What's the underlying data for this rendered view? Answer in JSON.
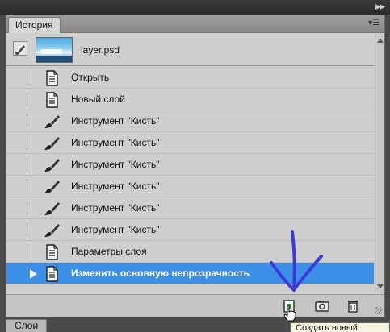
{
  "panel": {
    "tab_label": "История",
    "menu_icon": "panel-menu-icon",
    "collapse_icon": "double-arrow-right-icon"
  },
  "snapshot": {
    "name": "layer.psd"
  },
  "history": [
    {
      "label": "Открыть",
      "icon": "document-icon",
      "selected": false
    },
    {
      "label": "Новый слой",
      "icon": "document-icon",
      "selected": false
    },
    {
      "label": "Инструмент \"Кисть\"",
      "icon": "brush-icon",
      "selected": false
    },
    {
      "label": "Инструмент \"Кисть\"",
      "icon": "brush-icon",
      "selected": false
    },
    {
      "label": "Инструмент \"Кисть\"",
      "icon": "brush-icon",
      "selected": false
    },
    {
      "label": "Инструмент \"Кисть\"",
      "icon": "brush-icon",
      "selected": false
    },
    {
      "label": "Инструмент \"Кисть\"",
      "icon": "brush-icon",
      "selected": false
    },
    {
      "label": "Инструмент \"Кисть\"",
      "icon": "brush-icon",
      "selected": false
    },
    {
      "label": "Параметры слоя",
      "icon": "document-icon",
      "selected": false
    },
    {
      "label": "Изменить основную непрозрачность",
      "icon": "document-icon",
      "selected": true
    }
  ],
  "footer": {
    "buttons": [
      "new-document-from-state-icon",
      "new-snapshot-icon",
      "trash-icon"
    ]
  },
  "tooltip": {
    "text": "Создать новый"
  },
  "bottom_tab": {
    "label": "Слои"
  },
  "colors": {
    "selection": "#3b8fe6",
    "annotation": "#3a3ad8"
  }
}
